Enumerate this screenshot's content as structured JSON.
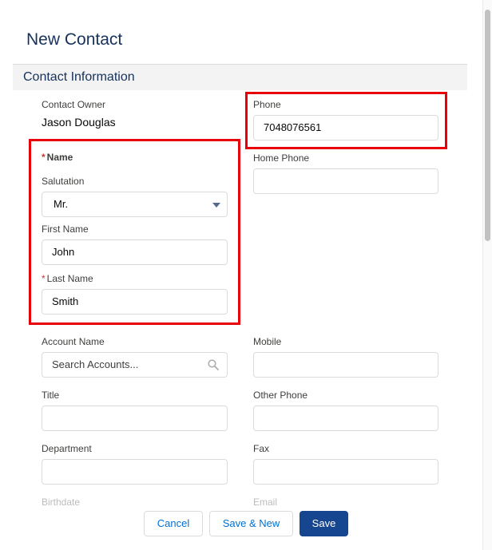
{
  "modal": {
    "title": "New Contact"
  },
  "section": {
    "title": "Contact Information"
  },
  "fields": {
    "contact_owner": {
      "label": "Contact Owner",
      "value": "Jason Douglas"
    },
    "phone": {
      "label": "Phone",
      "value": "7048076561"
    },
    "name": {
      "label": "Name",
      "required_mark": "*"
    },
    "home_phone": {
      "label": "Home Phone",
      "value": ""
    },
    "salutation": {
      "label": "Salutation",
      "value": "Mr."
    },
    "first_name": {
      "label": "First Name",
      "value": "John"
    },
    "last_name": {
      "label": "Last Name",
      "required_mark": "*",
      "value": "Smith"
    },
    "account_name": {
      "label": "Account Name",
      "placeholder": "Search Accounts..."
    },
    "mobile": {
      "label": "Mobile",
      "value": ""
    },
    "title": {
      "label": "Title",
      "value": ""
    },
    "other_phone": {
      "label": "Other Phone",
      "value": ""
    },
    "department": {
      "label": "Department",
      "value": ""
    },
    "fax": {
      "label": "Fax",
      "value": ""
    },
    "birthdate": {
      "label": "Birthdate"
    },
    "email": {
      "label": "Email"
    }
  },
  "footer": {
    "cancel_label": "Cancel",
    "save_new_label": "Save & New",
    "save_label": "Save"
  },
  "icons": {
    "search": "search-icon",
    "dropdown": "chevron-down-icon"
  },
  "colors": {
    "highlight": "#e8000b",
    "brand_button": "#16468f",
    "link": "#0070d2",
    "required": "#c23934"
  }
}
